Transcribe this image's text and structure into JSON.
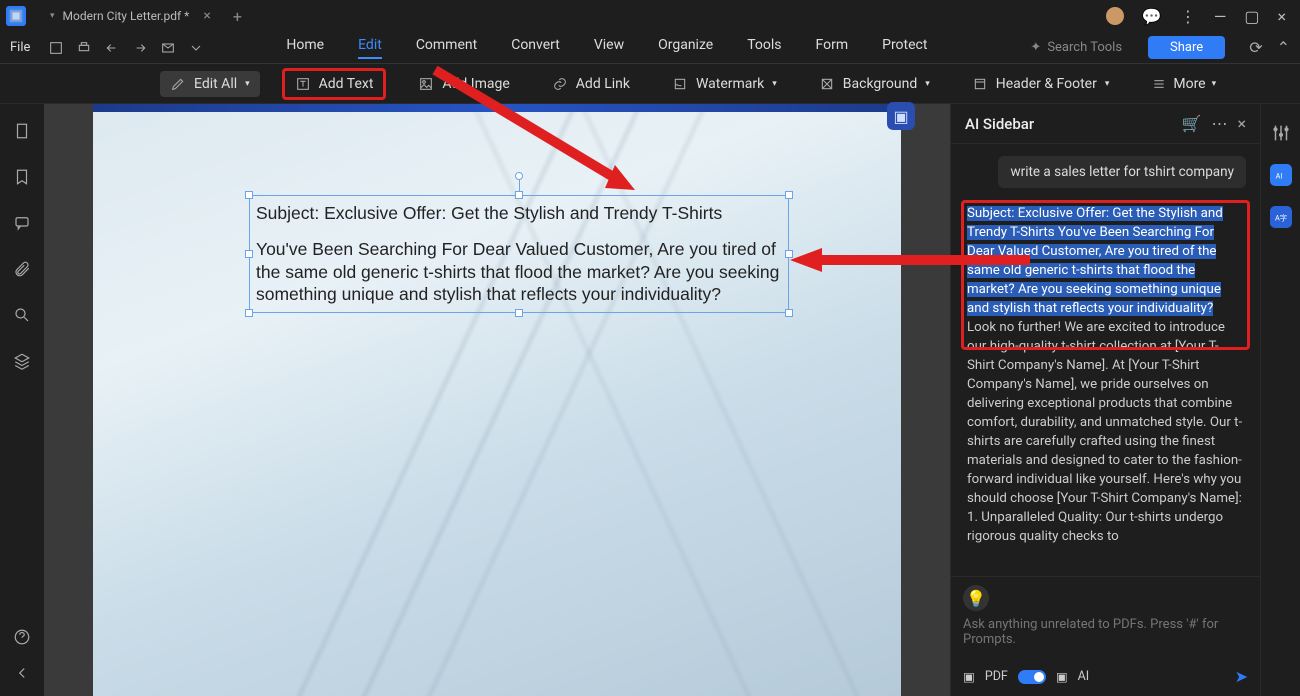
{
  "titlebar": {
    "tab_title": "Modern City Letter.pdf *"
  },
  "menubar": {
    "file": "File",
    "tabs": {
      "home": "Home",
      "edit": "Edit",
      "comment": "Comment",
      "convert": "Convert",
      "view": "View",
      "organize": "Organize",
      "tools": "Tools",
      "form": "Form",
      "protect": "Protect"
    },
    "search_placeholder": "Search Tools",
    "share": "Share"
  },
  "toolbar": {
    "edit_all": "Edit All",
    "add_text": "Add Text",
    "add_image": "Add Image",
    "add_link": "Add Link",
    "watermark": "Watermark",
    "background": "Background",
    "header_footer": "Header & Footer",
    "more": "More"
  },
  "document": {
    "subject_line": "Subject: Exclusive Offer: Get the Stylish and Trendy T-Shirts",
    "body": "You've Been Searching For Dear Valued Customer, Are you tired of the same old generic t-shirts that flood the market? Are you seeking something unique and stylish that reflects your individuality?"
  },
  "ai": {
    "title": "AI Sidebar",
    "user_prompt": "write a sales letter for tshirt company",
    "highlighted": "Subject: Exclusive Offer: Get the Stylish and Trendy T-Shirts You've Been Searching For Dear Valued Customer, Are you tired of the same old generic t-shirts that flood the market? Are you seeking something unique and stylish that reflects your individuality?",
    "rest": " Look no further! We are excited to introduce our high-quality t-shirt collection at [Your T-Shirt Company's Name]. At [Your T-Shirt Company's Name], we pride ourselves on delivering exceptional products that combine comfort, durability, and unmatched style. Our t-shirts are carefully crafted using the finest materials and designed to cater to the fashion-forward individual like yourself. Here's why you should choose [Your T-Shirt Company's Name]: 1. Unparalleled Quality: Our t-shirts undergo rigorous quality checks to",
    "input_placeholder": "Ask anything unrelated to PDFs. Press '#' for Prompts.",
    "badge_pdf": "PDF",
    "badge_ai": "AI"
  }
}
